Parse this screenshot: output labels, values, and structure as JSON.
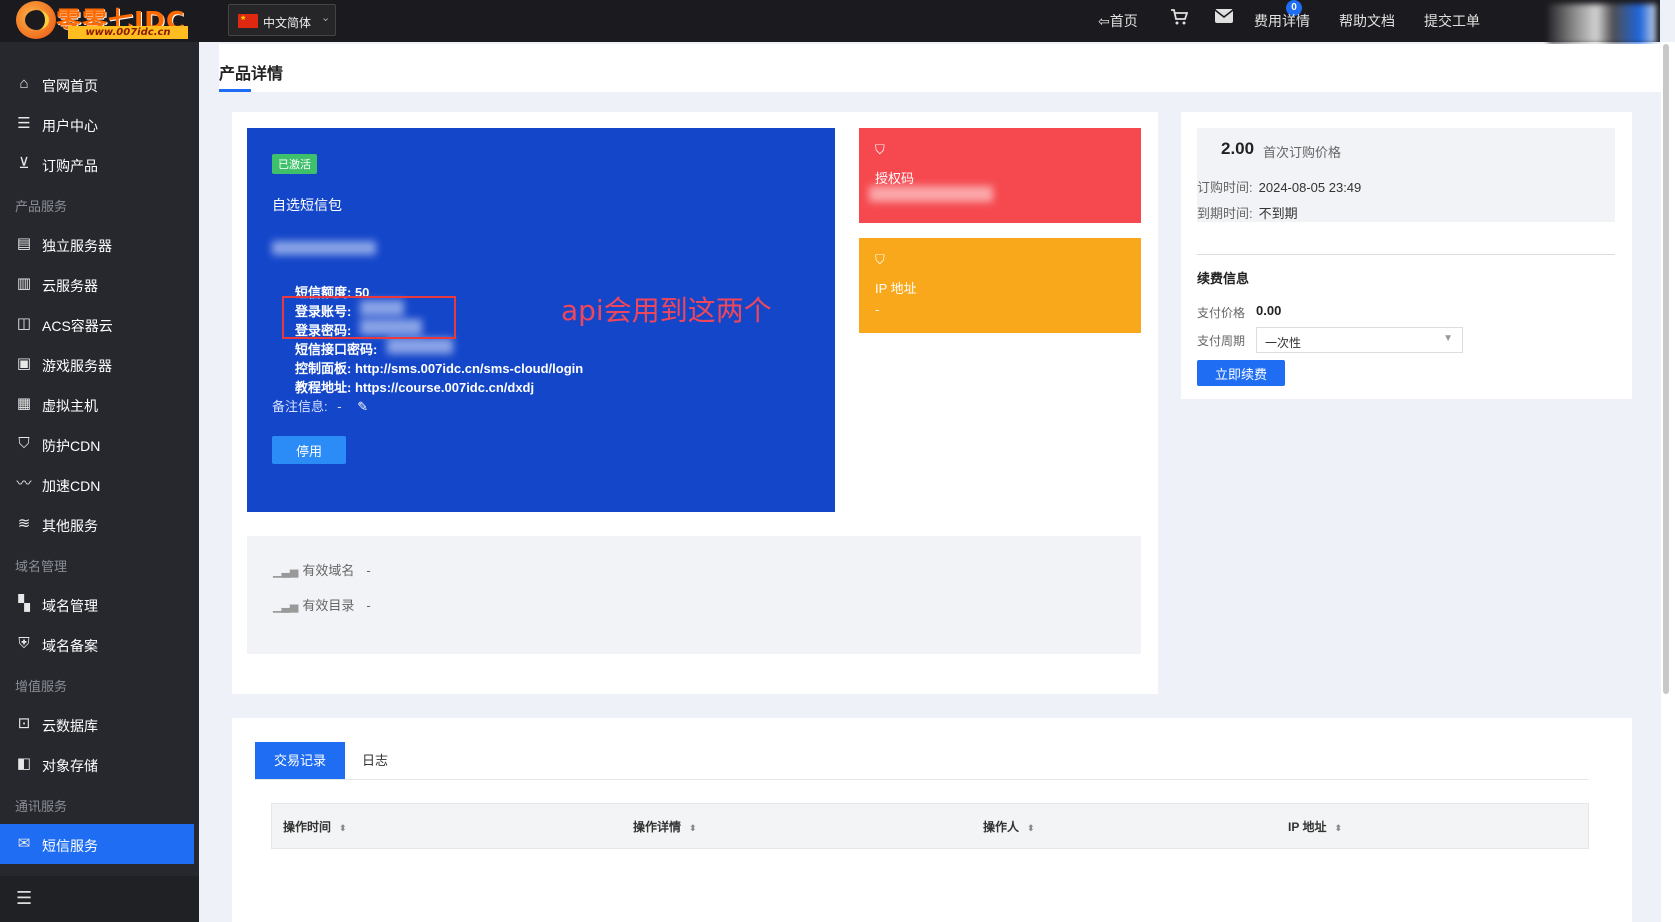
{
  "topbar": {
    "logo_text": "零零七IDC",
    "logo_url": "www.007idc.cn",
    "language": "中文简体",
    "nav_home": "首页",
    "mail_badge": "0",
    "nav_fee": "费用详情",
    "nav_help": "帮助文档",
    "nav_ticket": "提交工单"
  },
  "sidebar": {
    "items": [
      {
        "label": "官网首页",
        "icon": "home-icon"
      },
      {
        "label": "用户中心",
        "icon": "user-icon"
      },
      {
        "label": "订购产品",
        "icon": "cart-icon"
      },
      {
        "label": "独立服务器",
        "icon": "server-icon"
      },
      {
        "label": "云服务器",
        "icon": "cloud-server-icon"
      },
      {
        "label": "ACS容器云",
        "icon": "container-icon"
      },
      {
        "label": "游戏服务器",
        "icon": "game-server-icon"
      },
      {
        "label": "虚拟主机",
        "icon": "virtual-host-icon"
      },
      {
        "label": "防护CDN",
        "icon": "shield-icon"
      },
      {
        "label": "加速CDN",
        "icon": "speed-icon"
      },
      {
        "label": "其他服务",
        "icon": "sliders-icon"
      },
      {
        "label": "域名管理",
        "icon": "grid-icon"
      },
      {
        "label": "域名备案",
        "icon": "check-shield-icon"
      },
      {
        "label": "云数据库",
        "icon": "database-icon"
      },
      {
        "label": "对象存储",
        "icon": "storage-icon"
      },
      {
        "label": "短信服务",
        "icon": "mail-icon"
      }
    ],
    "groups": [
      "产品服务",
      "域名管理",
      "增值服务",
      "通讯服务"
    ]
  },
  "page": {
    "title": "产品详情"
  },
  "product": {
    "status": "已激活",
    "name": "自选短信包",
    "quota_line": "短信额度: 50",
    "account_label": "登录账号:",
    "password_label": "登录密码:",
    "apikey_label": "短信接口密码:",
    "panel_line": "控制面板: http://sms.007idc.cn/sms-cloud/login",
    "tutorial_line": "教程地址: https://course.007idc.cn/dxdj",
    "remark_label": "备注信息:",
    "remark_value": "-",
    "stop_button": "停用",
    "annotation": "api会用到这两个"
  },
  "auth_card": {
    "title": "授权码",
    "color": "#f5494f"
  },
  "ip_card": {
    "title": "IP 地址",
    "value": "-",
    "color": "#f9a81b"
  },
  "domain_info": {
    "valid_domain_label": "有效域名",
    "valid_domain_value": "-",
    "valid_dir_label": "有效目录",
    "valid_dir_value": "-"
  },
  "price": {
    "amount": "2.00",
    "caption": "首次订购价格",
    "order_time_label": "订购时间:",
    "order_time": "2024-08-05 23:49",
    "expire_label": "到期时间:",
    "expire_value": "不到期"
  },
  "renew": {
    "title": "续费信息",
    "pay_price_label": "支付价格",
    "pay_price": "0.00",
    "period_label": "支付周期",
    "period_value": "一次性",
    "button": "立即续费"
  },
  "records": {
    "tabs": [
      "交易记录",
      "日志"
    ],
    "columns": [
      "操作时间",
      "操作详情",
      "操作人",
      "IP 地址"
    ]
  },
  "colors": {
    "accent": "#1f6df2",
    "product_card": "#1446c9",
    "sidebar": "#26282e"
  }
}
